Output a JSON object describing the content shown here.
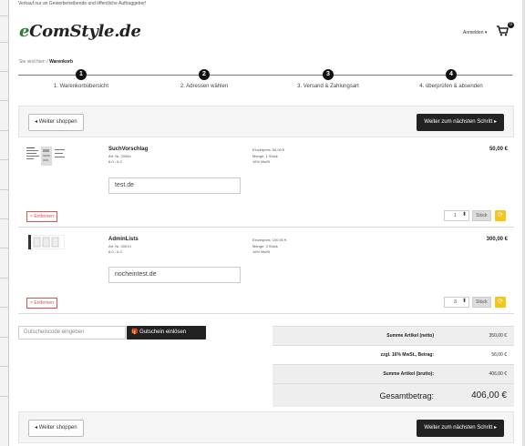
{
  "topnote": "Verkauf nur an Gewerbetreibende und öffentliche Auftraggeber!",
  "logo": {
    "e": "e",
    "rest": "ComStyle.de"
  },
  "header": {
    "login_label": "Anmelden",
    "cart_count": "0"
  },
  "breadcrumb": {
    "prefix": "Sie sind hier:",
    "current": "Warenkorb"
  },
  "steps": [
    {
      "num": "1",
      "label": "1. Warenkorbübersicht"
    },
    {
      "num": "2",
      "label": "2. Adressen wählen"
    },
    {
      "num": "3",
      "label": "3. Versand & Zahlungsart"
    },
    {
      "num": "4",
      "label": "4. überprüfen & absenden"
    }
  ],
  "nav": {
    "back_label": "Weiter shoppen",
    "next_label": "Weiter zum nächsten Schritt"
  },
  "products": [
    {
      "name": "SuchVorschlag",
      "art": "Art. Nr. 20064",
      "version": "6.0 - 6.2",
      "input_value": "test.de",
      "unit_price": "Einzelpreis: 50,00 €",
      "quantity_text": "Menge: 1 Stück",
      "tax": "16% MwSt",
      "total": "50,00 €",
      "remove_label": "Entfernen",
      "qty": "1",
      "unit": "Stück"
    },
    {
      "name": "AdminLists",
      "art": "Art. Nr. 20013",
      "version": "6.0 - 6.2",
      "input_value": "nocheintest.de",
      "unit_price": "Einzelpreis: 100,00 €",
      "quantity_text": "Menge: 3 Stück",
      "tax": "16% MwSt",
      "total": "300,00 €",
      "remove_label": "Entfernen",
      "qty": "3",
      "unit": "Stück"
    }
  ],
  "coupon": {
    "placeholder": "Gutscheincode eingeben",
    "button_label": "Gutschein einlösen"
  },
  "summary": {
    "net_label": "Summe Artikel (netto)",
    "net_value": "350,00 €",
    "tax_label": "zzgl. 16% MwSt., Betrag:",
    "tax_value": "56,00 €",
    "gross_label": "Summe Artikel (brutto):",
    "gross_value": "406,00 €",
    "total_label": "Gesamtbetrag:",
    "total_value": "406,00 €"
  }
}
